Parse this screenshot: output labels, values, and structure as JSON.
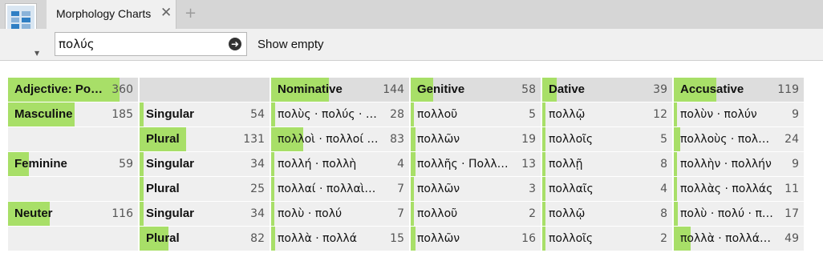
{
  "app": {
    "icon_text": "Morphology Charts"
  },
  "tab": {
    "label": "Morphology Charts",
    "close_icon": "close-icon",
    "add_icon": "plus-icon"
  },
  "toolbar": {
    "search_value": "πολύς",
    "go_icon": "arrow-right-circle-icon",
    "show_empty_label": "Show empty"
  },
  "colors": {
    "bar": "#a8df68",
    "cell": "#efefef",
    "header": "#dddddd"
  },
  "header": {
    "root": {
      "label": "Adjective: Posit…",
      "count": "360",
      "fill": 0.86
    },
    "cases": [
      {
        "label": "Nominative",
        "count": "144",
        "fill": 0.42
      },
      {
        "label": "Genitive",
        "count": "58",
        "fill": 0.17
      },
      {
        "label": "Dative",
        "count": "39",
        "fill": 0.11
      },
      {
        "label": "Accusative",
        "count": "119",
        "fill": 0.33
      }
    ]
  },
  "genders": [
    {
      "label": "Masculine",
      "count": "185",
      "fill": 0.51
    },
    {
      "label": "Feminine",
      "count": "59",
      "fill": 0.16
    },
    {
      "label": "Neuter",
      "count": "116",
      "fill": 0.32
    }
  ],
  "rows": [
    {
      "number": "Singular",
      "count": "54",
      "fill": 0.03,
      "forms": [
        {
          "text": "πολὺς · πολύς · πλ…",
          "count": "28",
          "fill": 0.03
        },
        {
          "text": "πολλοῦ",
          "count": "5",
          "fill": 0.01
        },
        {
          "text": "πολλῷ",
          "count": "12",
          "fill": 0.02
        },
        {
          "text": "πολὺν · πολύν",
          "count": "9",
          "fill": 0.02
        }
      ]
    },
    {
      "number": "Plural",
      "count": "131",
      "fill": 0.36,
      "forms": [
        {
          "text": "πολλοὶ · πολλοί · …",
          "count": "83",
          "fill": 0.23
        },
        {
          "text": "πολλῶν",
          "count": "19",
          "fill": 0.04
        },
        {
          "text": "πολλοῖς",
          "count": "5",
          "fill": 0.01
        },
        {
          "text": "πολλοὺς · πολλούς",
          "count": "24",
          "fill": 0.05
        }
      ]
    },
    {
      "number": "Singular",
      "count": "34",
      "fill": 0.03,
      "forms": [
        {
          "text": "πολλή · πολλὴ",
          "count": "4",
          "fill": 0.01
        },
        {
          "text": "πολλῆς · Πολλῆς",
          "count": "13",
          "fill": 0.04
        },
        {
          "text": "πολλῇ",
          "count": "8",
          "fill": 0.02
        },
        {
          "text": "πολλὴν · πολλήν",
          "count": "9",
          "fill": 0.02
        }
      ]
    },
    {
      "number": "Plural",
      "count": "25",
      "fill": 0.03,
      "forms": [
        {
          "text": "πολλαί · πολλαὶ · …",
          "count": "7",
          "fill": 0.01
        },
        {
          "text": "πολλῶν",
          "count": "3",
          "fill": 0.01
        },
        {
          "text": "πολλαῖς",
          "count": "4",
          "fill": 0.01
        },
        {
          "text": "πολλὰς · πολλάς",
          "count": "11",
          "fill": 0.02
        }
      ]
    },
    {
      "number": "Singular",
      "count": "34",
      "fill": 0.03,
      "forms": [
        {
          "text": "πολὺ · πολύ",
          "count": "7",
          "fill": 0.01
        },
        {
          "text": "πολλοῦ",
          "count": "2",
          "fill": 0.01
        },
        {
          "text": "πολλῷ",
          "count": "8",
          "fill": 0.02
        },
        {
          "text": "πολὺ · πολύ · πλ…",
          "count": "17",
          "fill": 0.03
        }
      ]
    },
    {
      "number": "Plural",
      "count": "82",
      "fill": 0.22,
      "forms": [
        {
          "text": "πολλὰ · πολλά",
          "count": "15",
          "fill": 0.03
        },
        {
          "text": "πολλῶν",
          "count": "16",
          "fill": 0.04
        },
        {
          "text": "πολλοῖς",
          "count": "2",
          "fill": 0.01
        },
        {
          "text": "πολλὰ · πολλά · …",
          "count": "49",
          "fill": 0.13
        }
      ]
    }
  ]
}
